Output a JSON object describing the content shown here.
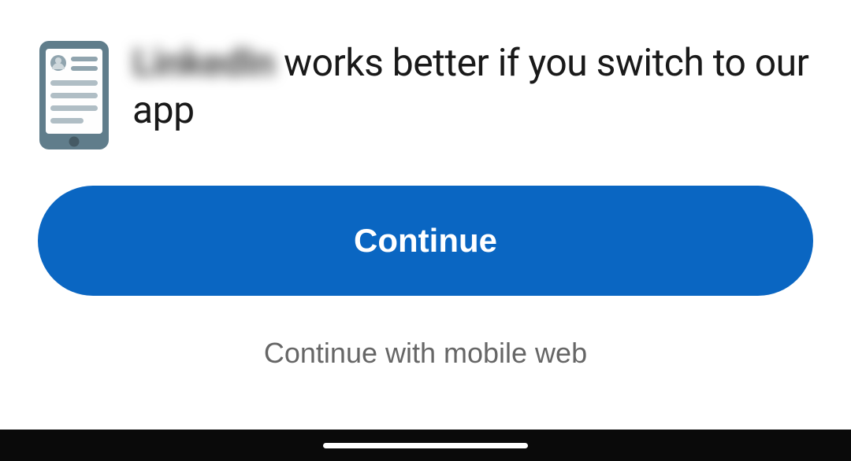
{
  "banner": {
    "brand_text": "LinkedIn",
    "headline_rest": " works better if you switch to our app"
  },
  "buttons": {
    "continue_label": "Continue",
    "mobile_web_label": "Continue with mobile web"
  },
  "colors": {
    "primary": "#0a66c2",
    "text": "#191919",
    "muted": "#666666"
  }
}
